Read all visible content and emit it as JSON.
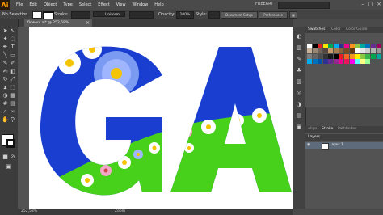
{
  "app": {
    "logo": "Ai",
    "workspace": "FREEART"
  },
  "menu": [
    "File",
    "Edit",
    "Object",
    "Type",
    "Select",
    "Effect",
    "View",
    "Window",
    "Help"
  ],
  "control_bar": {
    "selection_label": "No Selection",
    "stroke_label": "Stroke:",
    "brush_value": "Uniform",
    "opacity_label": "Opacity:",
    "opacity_value": "100%",
    "style_label": "Style:",
    "document_setup": "Document Setup",
    "preferences": "Preferences"
  },
  "document_tab": {
    "label": "flowers.ai* @ 252,58% (RGB/Preview)",
    "close": "×"
  },
  "artwork": {
    "letters": [
      "G",
      "A"
    ],
    "colors": {
      "sky": "#1a3fd0",
      "grass": "#47d11a",
      "petal": "#ffffff",
      "center": "#f5c400",
      "blue_flower": "#7b9bf2"
    }
  },
  "panels": {
    "swatch_tabs": [
      "Swatches",
      "Color",
      "Color Guide"
    ],
    "align_tabs": [
      "Align",
      "Stroke",
      "Pathfinder"
    ],
    "layers_tab": "Layers",
    "layer": {
      "name": "Layer 1",
      "visibility_icon": "eye-icon"
    },
    "swatch_colors": [
      "#ffffff",
      "#000000",
      "#e31e24",
      "#f7e600",
      "#00a651",
      "#00aeef",
      "#2e3192",
      "#ec008c",
      "#f7941d",
      "#8dc63f",
      "#00a99d",
      "#0072bc",
      "#662d91",
      "#9e005d",
      "#c7b299",
      "#998675",
      "#736357",
      "#534741",
      "#c69c6d",
      "#a67c52",
      "#8c6239",
      "#754c24",
      "#603813",
      "#ffffff",
      "#e6e6e6",
      "#cccccc",
      "#b3b3b3",
      "#999999",
      "#808080",
      "#666666",
      "#4d4d4d",
      "#333333",
      "#1a1a1a",
      "#000000",
      "#ed1c24",
      "#f26522",
      "#f7941d",
      "#fff200",
      "#8dc63f",
      "#39b54a",
      "#00a651",
      "#00a99d",
      "#00aeef",
      "#0072bc",
      "#0054a6",
      "#2e3192",
      "#662d91",
      "#92278f",
      "#ec008c",
      "#ed145b",
      "#f0e",
      "#5ff",
      "#ff8",
      "#9f9"
    ]
  },
  "status": {
    "zoom": "252,58%",
    "mode": "Zoom"
  }
}
